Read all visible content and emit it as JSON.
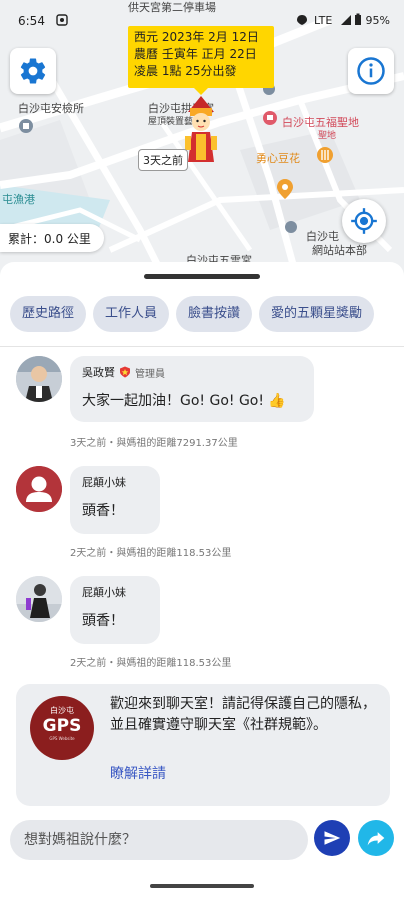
{
  "status": {
    "time": "6:54",
    "network": "LTE",
    "battery": "95%"
  },
  "map": {
    "labels": {
      "top_partial": "供天宮第二停車場",
      "police": "白沙屯安檢所",
      "temple_main": "白沙屯拱天宮",
      "temple_sub": "屋頂裝置藝術",
      "saint_temple": "白沙屯五福聖地",
      "temple_short": "聖地",
      "dessert": "勇心豆花",
      "harbor": "屯漁港",
      "shengxing": "白沙屯",
      "station": "網站站本部",
      "wuyun": "白沙屯五雲宮"
    },
    "date_tooltip": {
      "line1": "西元 2023年 2月 12日",
      "line2": "農曆 壬寅年 正月 22日",
      "line3": "凌晨 1點 25分出發"
    },
    "days_ago_tag": "3天之前",
    "total_distance": "累計：0.0 公里"
  },
  "chips": [
    "歷史路徑",
    "工作人員",
    "臉書按讚",
    "愛的五顆星獎勵"
  ],
  "messages": [
    {
      "sender": "吳政賢",
      "role": "管理員",
      "text": "大家一起加油！Go! Go! Go! 👍",
      "meta": "3天之前・與媽祖的距離7291.37公里"
    },
    {
      "sender": "屁顛小妹",
      "text": "頭香！",
      "meta": "2天之前・與媽祖的距離118.53公里"
    },
    {
      "sender": "屁顛小妹",
      "text": "頭香！",
      "meta": "2天之前・與媽祖的距離118.53公里"
    }
  ],
  "welcome": {
    "logo_top": "白沙屯",
    "logo_main": "GPS",
    "logo_bottom": "GPS Website",
    "text": "歡迎來到聊天室！請記得保護自己的隱私，並且確實遵守聊天室《社群規範》。",
    "link": "瞭解詳請"
  },
  "input": {
    "placeholder": "想對媽祖說什麼？"
  },
  "colors": {
    "accent_blue": "#1e3fb4",
    "share_blue": "#21b7e8",
    "tooltip_yellow": "#ffd600",
    "logo_red": "#8b1e1e"
  }
}
